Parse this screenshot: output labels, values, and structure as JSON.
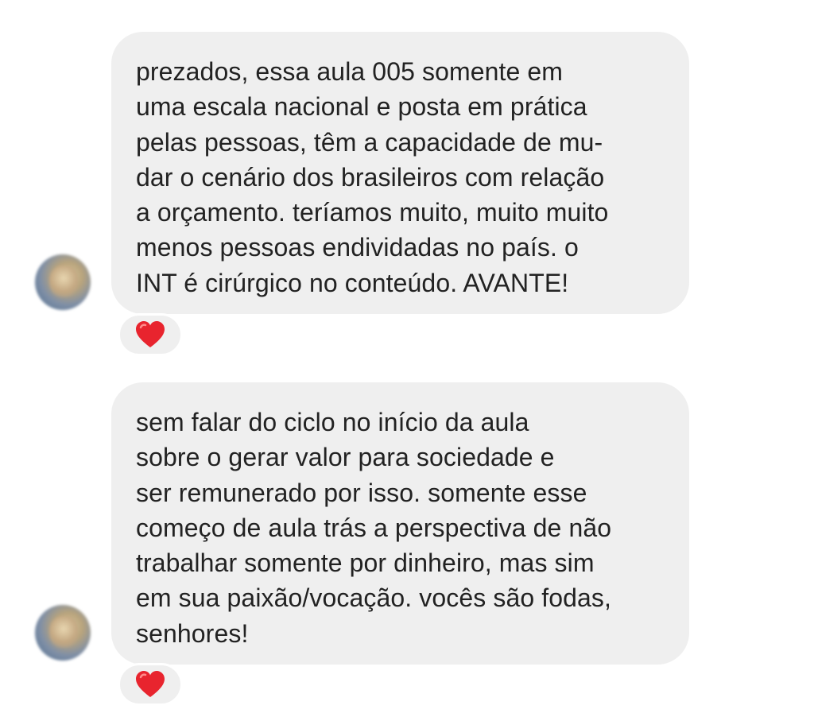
{
  "messages": [
    {
      "lines": [
        "prezados, essa aula 005 somente em",
        "uma escala nacional e posta em prática",
        "pelas pessoas, têm a capacidade de mu-",
        "dar o cenário dos brasileiros com relação",
        "a orçamento. teríamos muito, muito muito",
        "menos pessoas endividadas no país. o",
        "INT é cirúrgico no conteúdo. AVANTE!"
      ],
      "reaction": "heart-icon"
    },
    {
      "lines": [
        "sem falar do ciclo no início da aula",
        "sobre o gerar valor para sociedade e",
        "ser remunerado por isso. somente esse",
        "começo de aula trás a perspectiva de não",
        "trabalhar somente por dinheiro, mas sim",
        "em sua paixão/vocação. vocês são fodas,",
        "senhores!"
      ],
      "reaction": "heart-icon"
    }
  ],
  "colors": {
    "bubble": "#efefef",
    "text": "#222222",
    "heart": "#e8242e"
  }
}
